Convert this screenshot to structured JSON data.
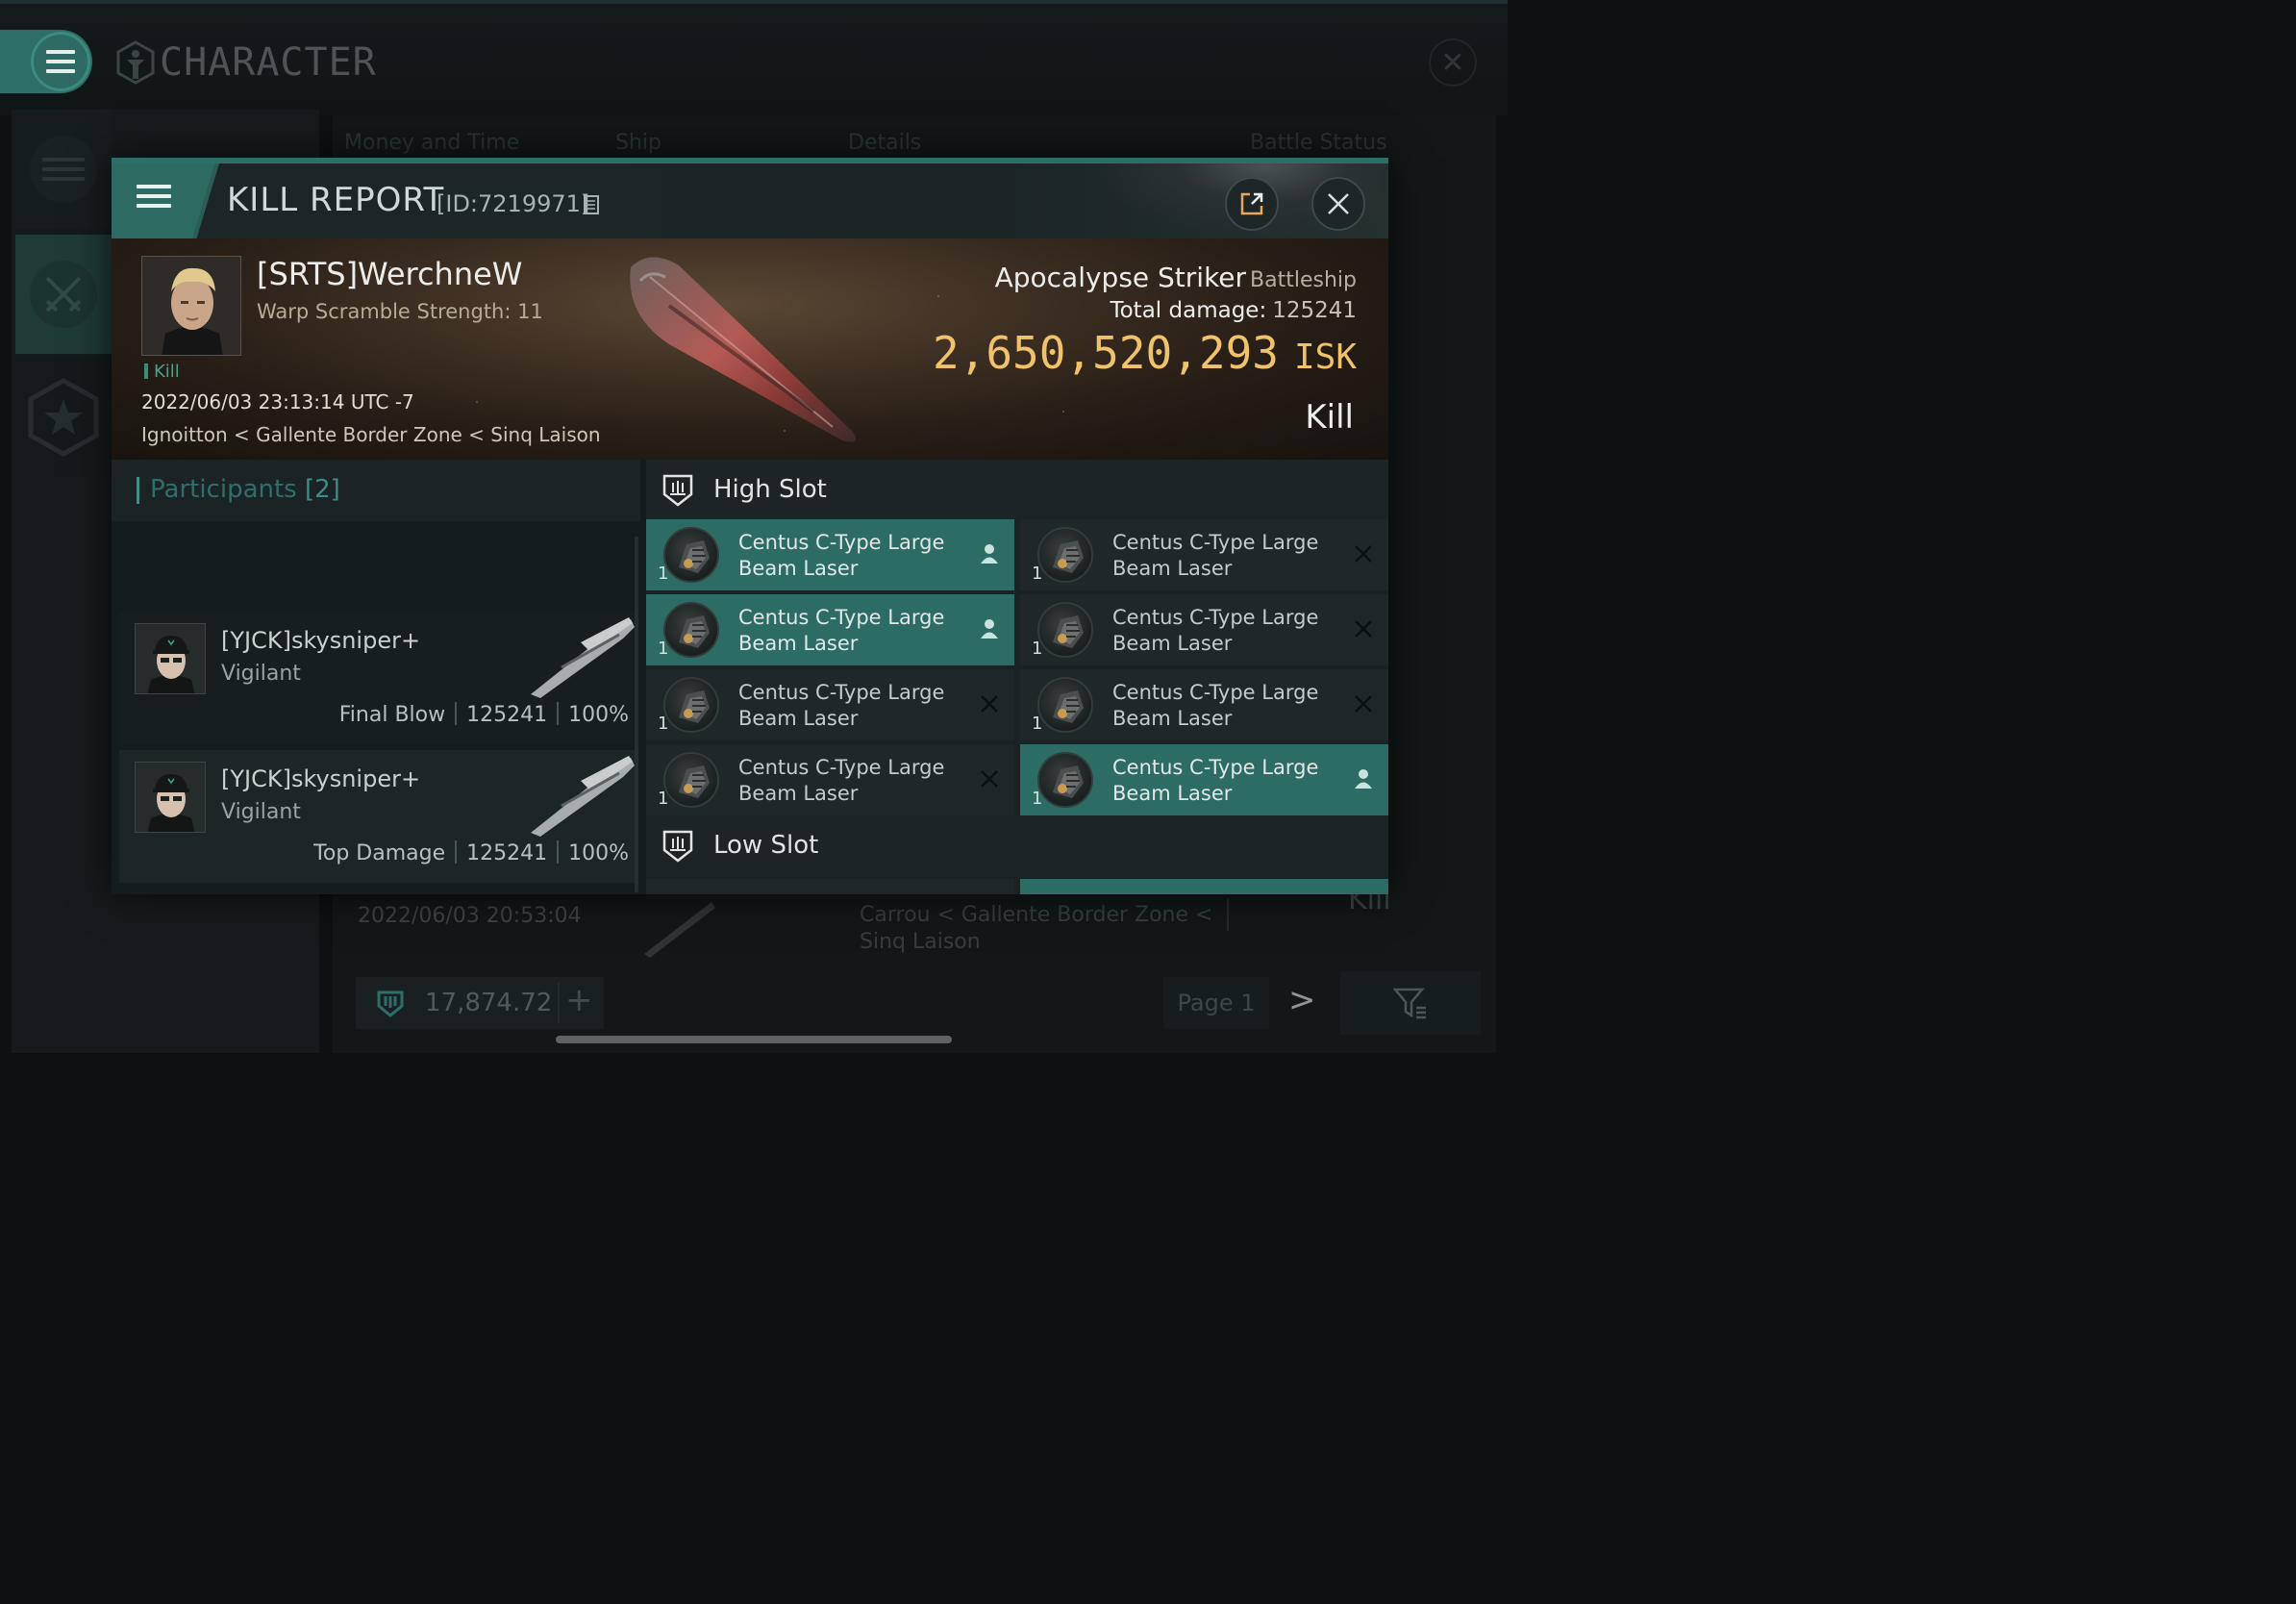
{
  "app": {
    "title": "CHARACTER"
  },
  "background": {
    "tabs": [
      "Money and Time",
      "Ship",
      "Details",
      "Battle Status"
    ],
    "row": {
      "date": "2022/06/03 20:53:04",
      "location": "Carrou < Gallente Border Zone < Sinq Laison",
      "status": "Kill"
    },
    "wallet": {
      "value": "17,874.72",
      "add": "+"
    },
    "pager": {
      "page": "Page 1",
      "next": ">"
    }
  },
  "kill_report": {
    "title": "KILL REPORT",
    "id": "[ID:7219971]",
    "victim": {
      "name": "[SRTS]WerchneW",
      "warp_scramble": "Warp Scramble Strength: 11",
      "tag": "Kill",
      "datetime": "2022/06/03 23:13:14 UTC -7",
      "location": "Ignoitton < Gallente Border Zone < Sinq Laison"
    },
    "ship": {
      "name": "Apocalypse Striker",
      "class": "Battleship",
      "total_damage_label": "Total damage:",
      "total_damage": "125241",
      "isk_value": "2,650,520,293",
      "isk_unit": "ISK",
      "status": "Kill"
    },
    "participants": {
      "label": "Participants",
      "count": "[2]",
      "list": [
        {
          "name": "[YJCK]skysniper+",
          "ship": "Vigilant",
          "role": "Final Blow",
          "damage": "125241",
          "percent": "100%"
        },
        {
          "name": "[YJCK]skysniper+",
          "ship": "Vigilant",
          "role": "Top Damage",
          "damage": "125241",
          "percent": "100%"
        }
      ]
    },
    "high_slot": {
      "label": "High Slot",
      "modules": [
        {
          "name": "Centus C-Type Large Beam Laser",
          "qty": "1",
          "state": "dropped"
        },
        {
          "name": "Centus C-Type Large Beam Laser",
          "qty": "1",
          "state": "destroyed"
        },
        {
          "name": "Centus C-Type Large Beam Laser",
          "qty": "1",
          "state": "dropped"
        },
        {
          "name": "Centus C-Type Large Beam Laser",
          "qty": "1",
          "state": "destroyed"
        },
        {
          "name": "Centus C-Type Large Beam Laser",
          "qty": "1",
          "state": "destroyed"
        },
        {
          "name": "Centus C-Type Large Beam Laser",
          "qty": "1",
          "state": "destroyed"
        },
        {
          "name": "Centus C-Type Large Beam Laser",
          "qty": "1",
          "state": "destroyed"
        },
        {
          "name": "Centus C-Type Large Beam Laser",
          "qty": "1",
          "state": "dropped"
        }
      ]
    },
    "low_slot": {
      "label": "Low Slot"
    }
  },
  "colors": {
    "accent": "#2d6c64",
    "isk": "#f0c26b",
    "participants": "#3e8c82"
  },
  "icons": [
    "menu-icon",
    "character-icon",
    "close-icon",
    "share-icon",
    "copy-icon",
    "high-slot-icon",
    "low-slot-icon",
    "person-icon",
    "x-icon",
    "star-icon",
    "swords-icon",
    "wallet-icon",
    "filter-icon"
  ]
}
